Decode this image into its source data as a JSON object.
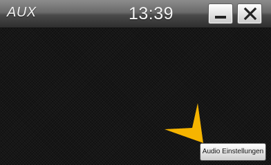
{
  "header": {
    "title": "AUX",
    "clock": "13:39"
  },
  "window_controls": {
    "minimize_icon": "minimize-icon",
    "close_icon": "close-icon"
  },
  "main": {
    "audio_settings_label": "Audio Einstellungen"
  },
  "annotation": {
    "icon": "pointer-arrow-icon",
    "color": "#f6b400"
  },
  "colors": {
    "title_bar": "#6a6a6a",
    "background": "#161616",
    "button_face": "#e6e6e6"
  }
}
